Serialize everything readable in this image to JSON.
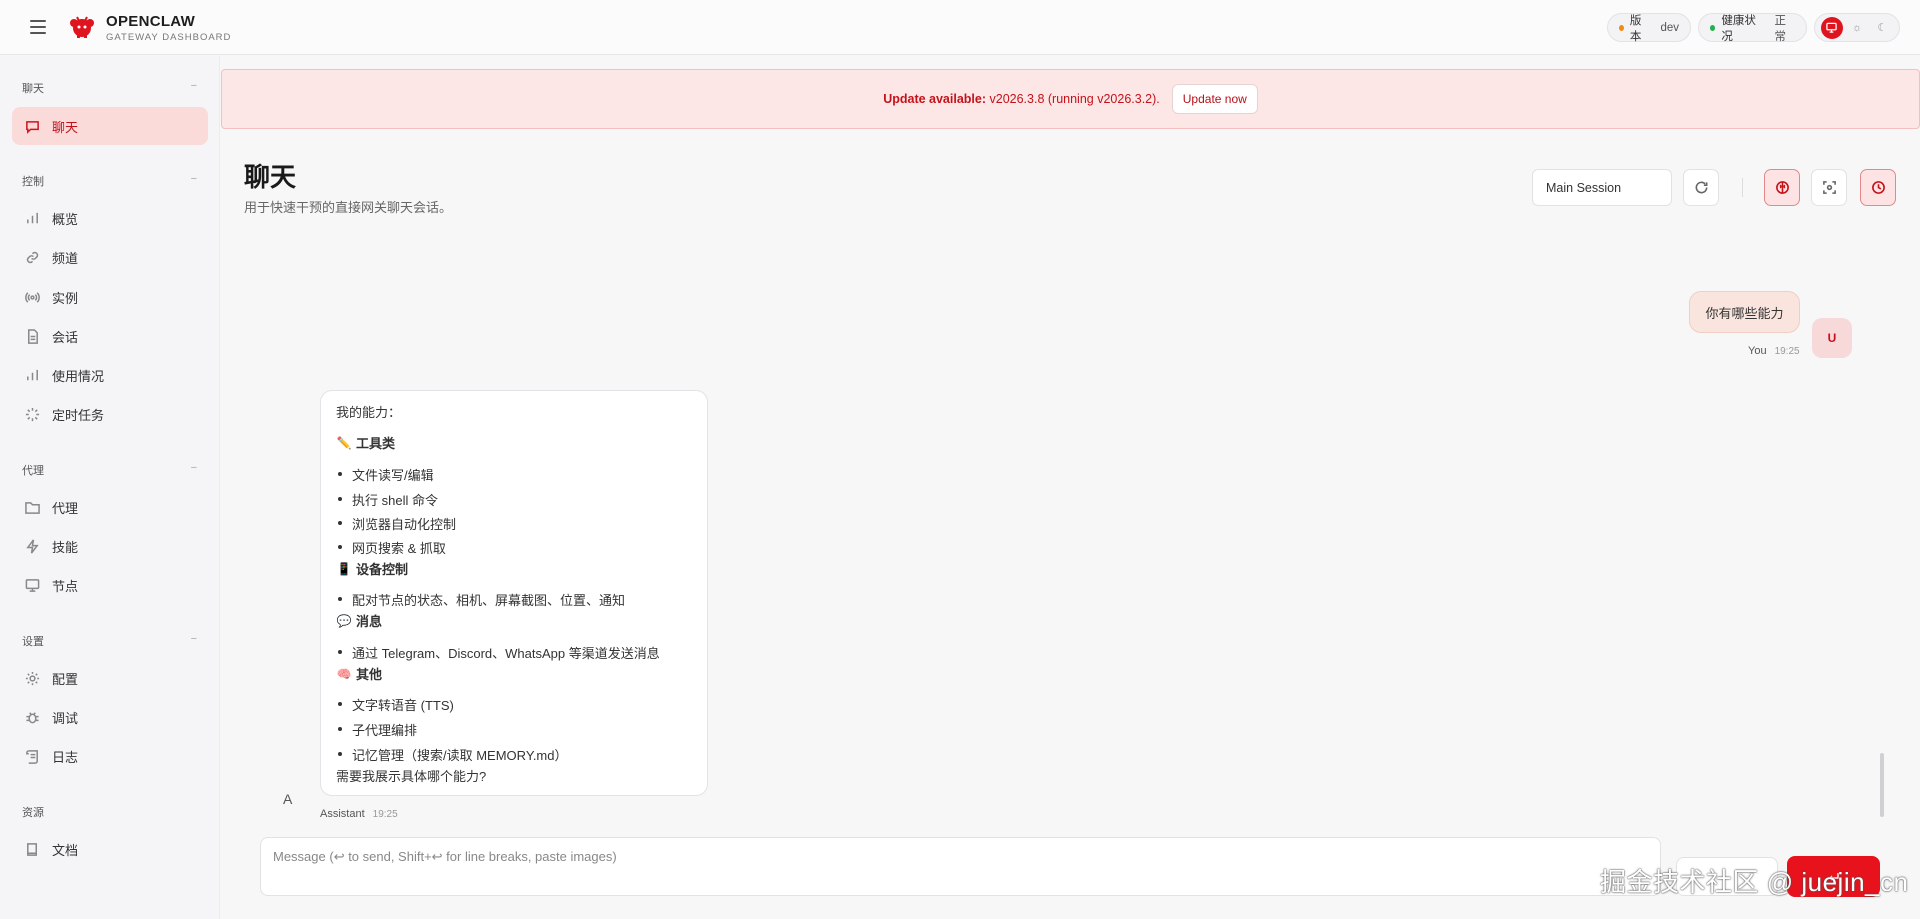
{
  "header": {
    "brand_title": "OPENCLAW",
    "brand_subtitle": "GATEWAY DASHBOARD",
    "version_label": "版本",
    "version_value": "dev",
    "health_label": "健康状况",
    "health_value": "正常",
    "colors": {
      "accent": "#e0141e",
      "version_dot": "#f08a18",
      "health_dot": "#22b14c"
    }
  },
  "sidebar": {
    "sections": [
      {
        "title": "聊天",
        "items": [
          {
            "label": "聊天",
            "icon": "chat-icon",
            "active": true
          }
        ]
      },
      {
        "title": "控制",
        "items": [
          {
            "label": "概览",
            "icon": "bar-chart-icon"
          },
          {
            "label": "频道",
            "icon": "link-icon"
          },
          {
            "label": "实例",
            "icon": "radio-icon"
          },
          {
            "label": "会话",
            "icon": "file-icon"
          },
          {
            "label": "使用情况",
            "icon": "bar-chart-icon"
          },
          {
            "label": "定时任务",
            "icon": "loader-icon"
          }
        ]
      },
      {
        "title": "代理",
        "items": [
          {
            "label": "代理",
            "icon": "folder-icon"
          },
          {
            "label": "技能",
            "icon": "zap-icon"
          },
          {
            "label": "节点",
            "icon": "monitor-icon"
          }
        ]
      },
      {
        "title": "设置",
        "items": [
          {
            "label": "配置",
            "icon": "gear-icon"
          },
          {
            "label": "调试",
            "icon": "bug-icon"
          },
          {
            "label": "日志",
            "icon": "scroll-icon"
          }
        ]
      },
      {
        "title": "资源",
        "items": [
          {
            "label": "文档",
            "icon": "book-icon"
          }
        ]
      }
    ]
  },
  "banner": {
    "bold": "Update available:",
    "text": "v2026.3.8 (running v2026.3.2).",
    "button": "Update now"
  },
  "page": {
    "title": "聊天",
    "subtitle": "用于快速干预的直接网关聊天会话。",
    "session_select": "Main Session"
  },
  "chat": {
    "user": {
      "text": "你有哪些能力",
      "avatar": "U",
      "name": "You",
      "time": "19:25"
    },
    "assistant": {
      "avatar": "A",
      "name": "Assistant",
      "time": "19:25",
      "intro": "我的能力：",
      "h1": "工具类",
      "tools": [
        "文件读写/编辑",
        "执行 shell 命令",
        "浏览器自动化控制",
        "网页搜索 & 抓取"
      ],
      "h2": "设备控制",
      "device": [
        "配对节点的状态、相机、屏幕截图、位置、通知"
      ],
      "h3": "消息",
      "messages": [
        "通过 Telegram、Discord、WhatsApp 等渠道发送消息"
      ],
      "h4": "其他",
      "other": [
        "文字转语音 (TTS)",
        "子代理编排",
        "记忆管理（搜索/读取 MEMORY.md）"
      ],
      "outro": "需要我展示具体哪个能力?"
    }
  },
  "composer": {
    "placeholder": "Message (↩ to send, Shift+↩ for line breaks, paste images)"
  },
  "watermark": "掘金技术社区 @ juejin_cn"
}
